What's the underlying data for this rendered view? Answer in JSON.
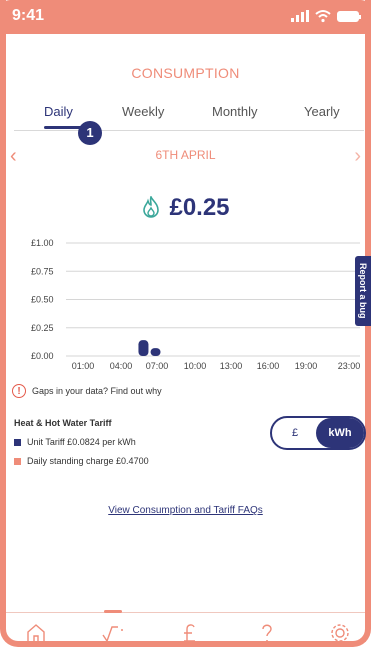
{
  "status": {
    "time": "9:41"
  },
  "screen": {
    "title": "CONSUMPTION"
  },
  "tabs": [
    {
      "label": "Daily",
      "active": true
    },
    {
      "label": "Weekly",
      "active": false
    },
    {
      "label": "Monthly",
      "active": false
    },
    {
      "label": "Yearly",
      "active": false
    }
  ],
  "step_badge": "1",
  "date_nav": {
    "date": "6TH APRIL",
    "prev_icon": "chevron-left-icon",
    "next_icon": "chevron-right-icon"
  },
  "total": {
    "amount": "£0.25",
    "icon": "gas-flame-icon"
  },
  "chart_data": {
    "type": "bar",
    "y_tick_labels": [
      "£1.00",
      "£0.75",
      "£0.50",
      "£0.25",
      "£0.00"
    ],
    "x_tick_labels": [
      "01:00",
      "04:00",
      "07:00",
      "10:00",
      "13:00",
      "16:00",
      "19:00",
      "23:00"
    ],
    "ylim": [
      0,
      1.0
    ],
    "bars": [
      {
        "hour": 6,
        "value": 0.14
      },
      {
        "hour": 7,
        "value": 0.07
      }
    ],
    "bar_color": "#2d3478"
  },
  "report_bug": "Report a bug",
  "gaps_notice": "Gaps in your data? Find out why",
  "tariff": {
    "heading": "Heat & Hot Water Tariff",
    "unit_rate": "Unit Tariff £0.0824 per kWh",
    "standing_charge": "Daily standing charge £0.4700",
    "unit_color": "#2d3478",
    "standing_color": "#ef8c79"
  },
  "unit_toggle": {
    "left": "£",
    "right": "kWh",
    "selected": "kWh"
  },
  "faq_link": "View Consumption and Tariff FAQs",
  "bottom_nav": [
    "home-icon",
    "consumption-icon",
    "pound-icon",
    "help-icon",
    "settings-icon"
  ],
  "colors": {
    "accent": "#ef8c79",
    "primary": "#2d3478",
    "flame": "#3aa79a"
  }
}
